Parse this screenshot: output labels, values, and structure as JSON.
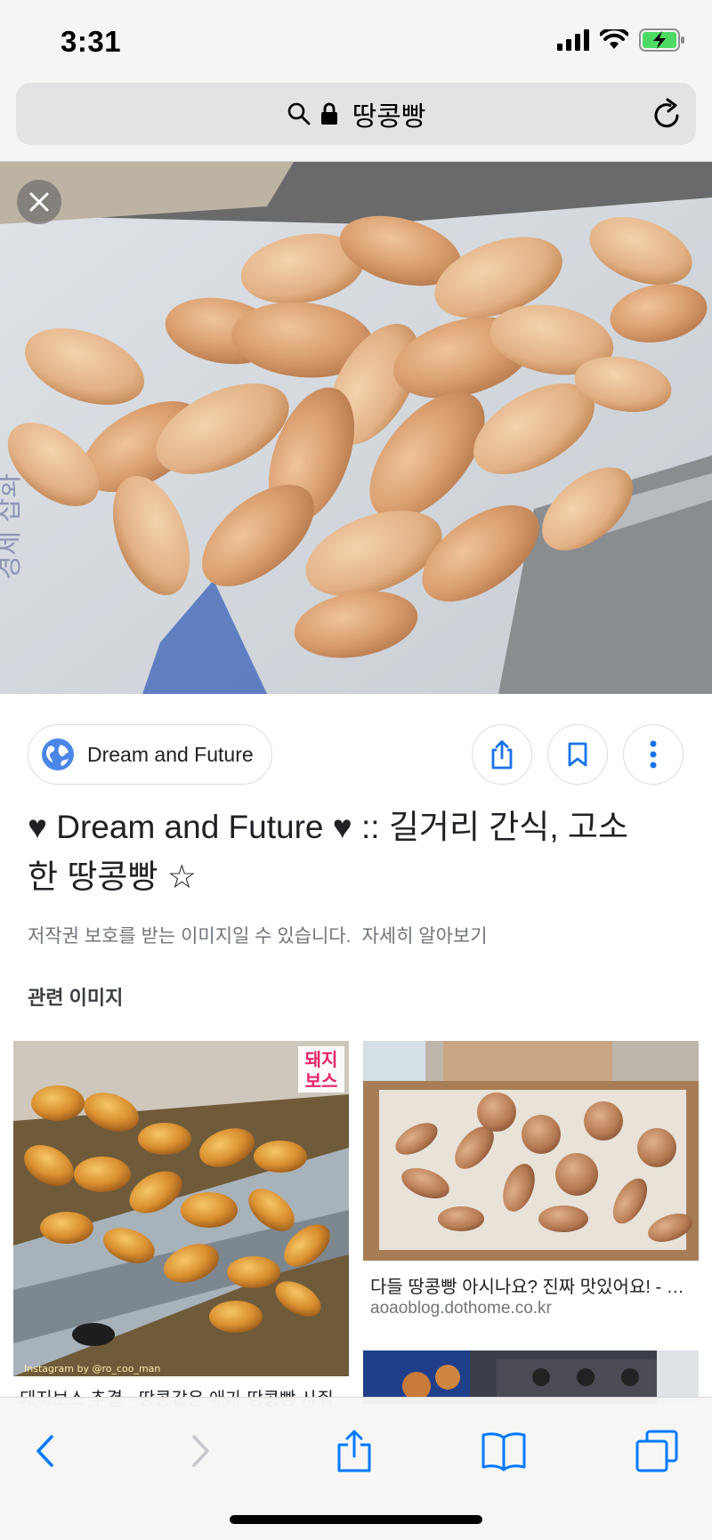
{
  "status": {
    "time": "3:31"
  },
  "browser": {
    "url_text": "땅콩빵"
  },
  "source": {
    "name": "Dream and Future"
  },
  "result": {
    "title": "♥ Dream and Future ♥ :: 길거리 간식, 고소한 땅콩빵 ☆",
    "copyright_notice": "저작권 보호를 받는 이미지일 수 있습니다.",
    "learn_more": "자세히 알아보기"
  },
  "related": {
    "heading": "관련 이미지",
    "items": [
      {
        "caption": "돼지보스 추결 - 땅콩같은 애가 땅콩빵 사줘",
        "domain": "",
        "badge": "돼지보스",
        "watermark": "Instagram by @ro_coo_man"
      },
      {
        "caption": "다들 땅콩빵 아시나요? 진짜 맛있어요! - 신...",
        "domain": "aoaoblog.dothome.co.kr"
      }
    ]
  },
  "colors": {
    "accent": "#1a73e8",
    "system_blue": "#007aff",
    "battery_green": "#4cd964"
  },
  "icons": [
    "search-icon",
    "lock-icon",
    "reload-icon",
    "close-icon",
    "globe-icon",
    "share-icon",
    "bookmark-icon",
    "more-vert-icon",
    "back-icon",
    "forward-icon",
    "safari-share-icon",
    "bookmarks-book-icon",
    "tabs-icon"
  ]
}
